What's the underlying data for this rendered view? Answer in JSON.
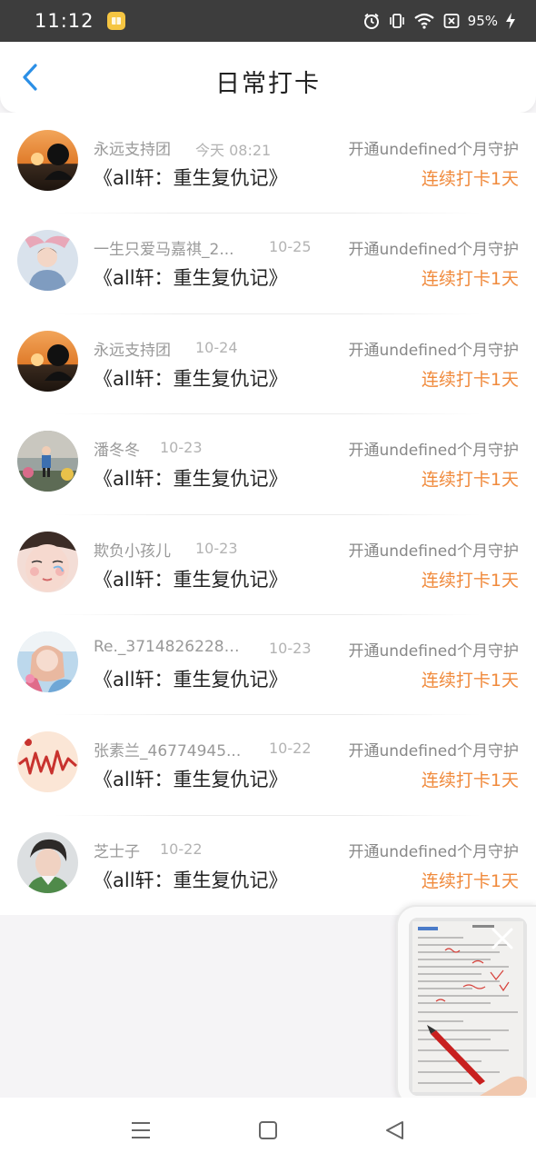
{
  "status_bar": {
    "time": "11:12",
    "battery": "95%",
    "icons": [
      "app-notification-icon",
      "alarm-icon",
      "vibrate-icon",
      "wifi-icon",
      "no-sim-icon",
      "charging-icon"
    ]
  },
  "header": {
    "title": "日常打卡",
    "back_icon": "chevron-left-icon",
    "accent_color": "#2b8fe6"
  },
  "colors": {
    "streak": "#f08a3c",
    "username": "#999999",
    "book": "#222222"
  },
  "checkins": [
    {
      "user": "永远支持团",
      "date": "今天 08:21",
      "book": "《all轩：重生复仇记》",
      "guard": "开通undefined个月守护",
      "streak": "连续打卡1天"
    },
    {
      "user": "一生只爱马嘉祺_2...",
      "date": "10-25",
      "book": "《all轩：重生复仇记》",
      "guard": "开通undefined个月守护",
      "streak": "连续打卡1天"
    },
    {
      "user": "永远支持团",
      "date": "10-24",
      "book": "《all轩：重生复仇记》",
      "guard": "开通undefined个月守护",
      "streak": "连续打卡1天"
    },
    {
      "user": "潘冬冬",
      "date": "10-23",
      "book": "《all轩：重生复仇记》",
      "guard": "开通undefined个月守护",
      "streak": "连续打卡1天"
    },
    {
      "user": "欺负小孩儿",
      "date": "10-23",
      "book": "《all轩：重生复仇记》",
      "guard": "开通undefined个月守护",
      "streak": "连续打卡1天"
    },
    {
      "user": "Re._37148262287...",
      "date": "10-23",
      "book": "《all轩：重生复仇记》",
      "guard": "开通undefined个月守护",
      "streak": "连续打卡1天"
    },
    {
      "user": "张素兰_46774945...",
      "date": "10-22",
      "book": "《all轩：重生复仇记》",
      "guard": "开通undefined个月守护",
      "streak": "连续打卡1天"
    },
    {
      "user": "芝士子",
      "date": "10-22",
      "book": "《all轩：重生复仇记》",
      "guard": "开通undefined个月守护",
      "streak": "连续打卡1天"
    }
  ],
  "floating_video": {
    "close_icon": "close-icon"
  },
  "nav_bar": {
    "icons": [
      "menu-icon",
      "home-square-icon",
      "back-triangle-icon"
    ]
  }
}
